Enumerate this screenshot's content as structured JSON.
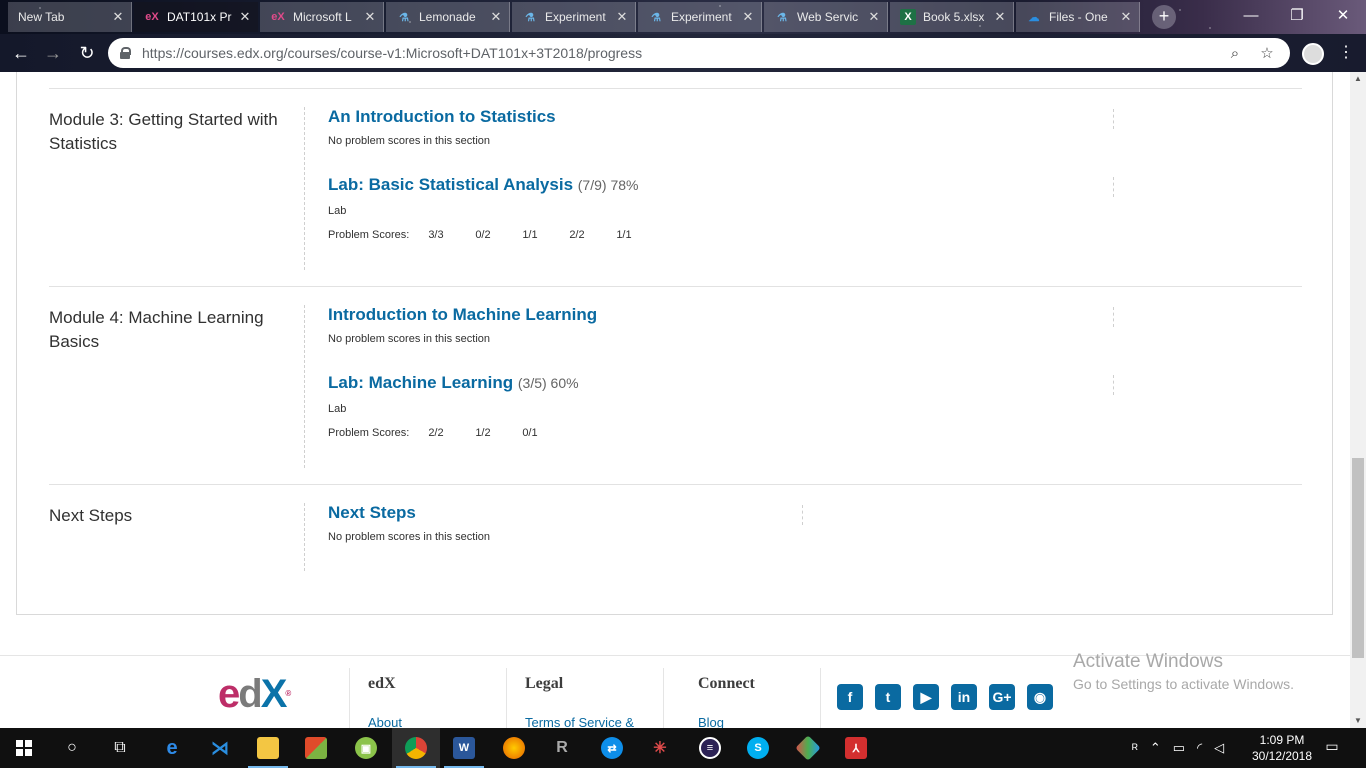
{
  "browser": {
    "tabs": [
      {
        "label": "New Tab",
        "icon": "blank-icon",
        "active": false
      },
      {
        "label": "DAT101x Pr",
        "icon": "edx-icon",
        "active": true
      },
      {
        "label": "Microsoft L",
        "icon": "edx-icon",
        "active": false
      },
      {
        "label": "Lemonade",
        "icon": "flask-icon",
        "active": false
      },
      {
        "label": "Experiment",
        "icon": "flask-icon",
        "active": false
      },
      {
        "label": "Experiment",
        "icon": "flask-icon",
        "active": false
      },
      {
        "label": "Web Servic",
        "icon": "flask-icon",
        "active": false
      },
      {
        "label": "Book 5.xlsx",
        "icon": "excel-icon",
        "active": false
      },
      {
        "label": "Files - One",
        "icon": "onedrive-icon",
        "active": false
      }
    ],
    "url": "https://courses.edx.org/courses/course-v1:Microsoft+DAT101x+3T2018/progress"
  },
  "progress": {
    "chapters": [
      {
        "title": "Module 3: Getting Started with Statistics",
        "sections": [
          {
            "title": "An Introduction to Statistics",
            "score": "",
            "note": "No problem scores in this section"
          },
          {
            "title": "Lab: Basic Statistical Analysis",
            "score": "(7/9) 78%",
            "format": "Lab",
            "scores_label": "Problem Scores:",
            "scores": [
              "3/3",
              "0/2",
              "1/1",
              "2/2",
              "1/1"
            ]
          }
        ]
      },
      {
        "title": "Module 4: Machine Learning Basics",
        "sections": [
          {
            "title": "Introduction to Machine Learning",
            "score": "",
            "note": "No problem scores in this section"
          },
          {
            "title": "Lab: Machine Learning",
            "score": "(3/5) 60%",
            "format": "Lab",
            "scores_label": "Problem Scores:",
            "scores": [
              "2/2",
              "1/2",
              "0/1"
            ]
          }
        ]
      },
      {
        "title": "Next Steps",
        "sections": [
          {
            "title": "Next Steps",
            "score": "",
            "note": "No problem scores in this section"
          }
        ]
      }
    ]
  },
  "footer": {
    "logo": "edX",
    "columns": [
      {
        "heading": "edX",
        "link": "About"
      },
      {
        "heading": "Legal",
        "link": "Terms of Service &"
      },
      {
        "heading": "Connect",
        "link": "Blog"
      }
    ],
    "social": [
      "facebook-icon",
      "twitter-icon",
      "youtube-icon",
      "linkedin-icon",
      "google-plus-icon",
      "reddit-icon"
    ]
  },
  "watermark": {
    "line1": "Activate Windows",
    "line2": "Go to Settings to activate Windows."
  },
  "taskbar": {
    "time": "1:09 PM",
    "date": "30/12/2018"
  },
  "colors": {
    "link": "#0a6aa1",
    "text": "#313131",
    "edx_pink": "#bd2e68"
  }
}
